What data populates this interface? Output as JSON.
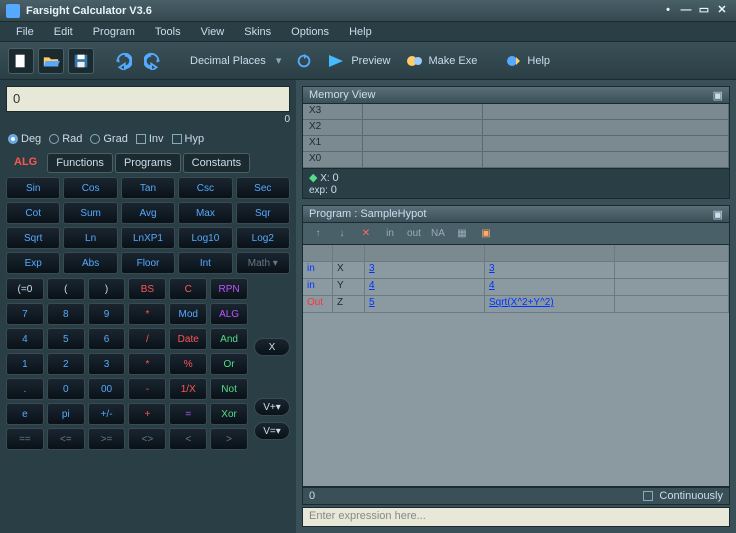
{
  "window": {
    "title": "Farsight Calculator V3.6"
  },
  "menu": [
    "File",
    "Edit",
    "Program",
    "Tools",
    "View",
    "Skins",
    "Options",
    "Help"
  ],
  "toolbar": {
    "decimal_places": "Decimal Places",
    "preview": "Preview",
    "makeexe": "Make Exe",
    "help": "Help"
  },
  "display": {
    "value": "0",
    "sub": "0"
  },
  "modes": {
    "deg": "Deg",
    "rad": "Rad",
    "grad": "Grad",
    "inv": "Inv",
    "hyp": "Hyp"
  },
  "tabs": {
    "alg": "ALG",
    "functions": "Functions",
    "programs": "Programs",
    "constants": "Constants"
  },
  "funcs": [
    [
      "Sin",
      "Cos",
      "Tan",
      "Csc",
      "Sec"
    ],
    [
      "Cot",
      "Sum",
      "Avg",
      "Max",
      "Sqr"
    ],
    [
      "Sqrt",
      "Ln",
      "LnXP1",
      "Log10",
      "Log2"
    ],
    [
      "Exp",
      "Abs",
      "Floor",
      "Int",
      "Math ▾"
    ]
  ],
  "nums": [
    [
      "(=0",
      "(",
      ")",
      "BS",
      "C",
      "RPN"
    ],
    [
      "7",
      "8",
      "9",
      "*",
      "Mod",
      "ALG"
    ],
    [
      "4",
      "5",
      "6",
      "/",
      "Date",
      "And"
    ],
    [
      "1",
      "2",
      "3",
      "*",
      "%",
      "Or"
    ],
    [
      ".",
      "0",
      "00",
      "-",
      "1/X",
      "Not"
    ],
    [
      "e",
      "pi",
      "+/-",
      "+",
      "=",
      "Xor"
    ],
    [
      "==",
      "<=",
      ">=",
      "<>",
      "<",
      ">"
    ]
  ],
  "sidebtns": {
    "x": "X",
    "vplus": "V+▾",
    "veq": "V=▾"
  },
  "memview": {
    "title": "Memory View",
    "rows": [
      "X3",
      "X2",
      "X1",
      "X0"
    ],
    "x": "0",
    "exp": "0"
  },
  "program": {
    "title": "Program : SampleHypot",
    "tb": [
      "↑",
      "↓",
      "✕",
      "in",
      "out",
      "NA",
      "▦",
      "▣"
    ],
    "rows": [
      {
        "io": "in",
        "var": "X",
        "a": "3",
        "b": "3"
      },
      {
        "io": "in",
        "var": "Y",
        "a": "4",
        "b": "4"
      },
      {
        "io": "Out",
        "var": "Z",
        "a": "5",
        "b": "Sqrt(X^2+Y^2)"
      }
    ],
    "status_left": "0",
    "continuously": "Continuously",
    "expr_placeholder": "Enter expression here..."
  }
}
